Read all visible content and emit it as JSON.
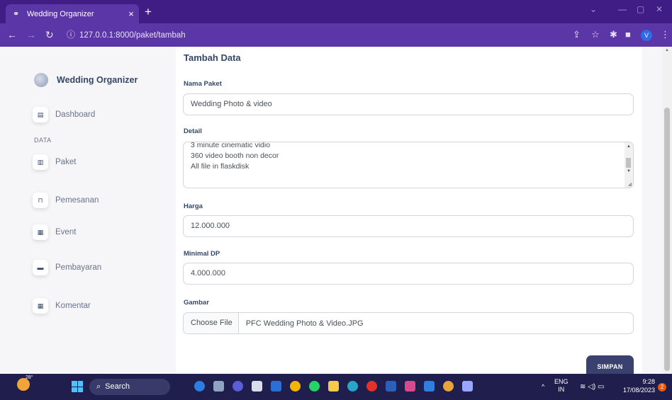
{
  "browser": {
    "tab_title": "Wedding Organizer",
    "tab_icon": "wedding-rings-icon",
    "url": "127.0.0.1:8000/paket/tambah"
  },
  "sidebar": {
    "brand": "Wedding Organizer",
    "section_label": "DATA",
    "items": [
      {
        "label": "Dashboard",
        "icon": "shop-icon"
      },
      {
        "label": "Paket",
        "icon": "chart-icon"
      },
      {
        "label": "Pemesanan",
        "icon": "cart-icon"
      },
      {
        "label": "Event",
        "icon": "calendar-icon"
      },
      {
        "label": "Pembayaran",
        "icon": "money-icon"
      },
      {
        "label": "Komentar",
        "icon": "calendar-icon"
      }
    ]
  },
  "form": {
    "title": "Tambah Data",
    "nama_paket": {
      "label": "Nama Paket",
      "value": "Wedding Photo & video"
    },
    "detail": {
      "label": "Detail",
      "lines": [
        "3 minute cinematic vidio",
        "360 video booth non decor",
        "All file in flaskdisk"
      ]
    },
    "harga": {
      "label": "Harga",
      "value": "12.000.000"
    },
    "minimal_dp": {
      "label": "Minimal DP",
      "value": "4.000.000"
    },
    "gambar": {
      "label": "Gambar",
      "button": "Choose File",
      "filename": "PFC Wedding Photo & Video.JPG"
    },
    "submit": "SIMPAN"
  },
  "taskbar": {
    "temperature": "28°",
    "search_label": "Search",
    "language_line1": "ENG",
    "language_line2": "IN",
    "time": "9:28",
    "date": "17/08/2023",
    "notification_count": "2"
  },
  "colors": {
    "chrome_dark": "#3f1d84",
    "chrome_light": "#5b36a6",
    "primary_button": "#3a416f",
    "taskbar": "#1f1e4d"
  }
}
